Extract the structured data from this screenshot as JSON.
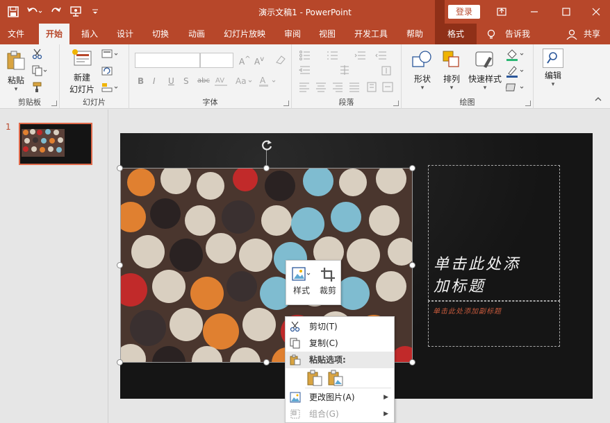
{
  "titlebar": {
    "doc_title": "演示文稿1  -  PowerPoint",
    "login_label": "登录",
    "qat_icons": [
      "save-icon",
      "undo-icon",
      "redo-icon",
      "presenter-icon",
      "customize-qat-icon"
    ]
  },
  "tabs": [
    {
      "label": "文件"
    },
    {
      "label": "开始"
    },
    {
      "label": "插入"
    },
    {
      "label": "设计"
    },
    {
      "label": "切换"
    },
    {
      "label": "动画"
    },
    {
      "label": "幻灯片放映"
    },
    {
      "label": "审阅"
    },
    {
      "label": "视图"
    },
    {
      "label": "开发工具"
    },
    {
      "label": "帮助"
    },
    {
      "label": "格式"
    },
    {
      "label": "告诉我"
    },
    {
      "label": "共享"
    }
  ],
  "ribbon": {
    "groups": {
      "clipboard": "剪贴板",
      "slides": "幻灯片",
      "font": "字体",
      "paragraph": "段落",
      "drawing": "绘图"
    },
    "paste_label": "粘贴",
    "new_slide_line1": "新建",
    "new_slide_line2": "幻灯片",
    "shapes_label": "形状",
    "arrange_label": "排列",
    "quick_styles_label": "快速样式",
    "edit_label": "编辑",
    "font_buttons": [
      "B",
      "I",
      "U",
      "S",
      "abc"
    ]
  },
  "thumbnails": {
    "slide_number": "1"
  },
  "slide": {
    "title_text_line1": "单击此处添",
    "title_text_line2": "加标题",
    "subtitle_text": "单击此处添加副标题"
  },
  "minibar": {
    "style_label": "样式",
    "crop_label": "裁剪"
  },
  "context_menu": {
    "cut": "剪切(T)",
    "copy": "复制(C)",
    "paste_options": "粘贴选项:",
    "change_picture": "更改图片(A)",
    "group": "组合(G)"
  },
  "colors": {
    "accent": "#b7472a",
    "ribbon_bg": "#f3f3f3",
    "slide_bg": "#1b1b1b"
  }
}
